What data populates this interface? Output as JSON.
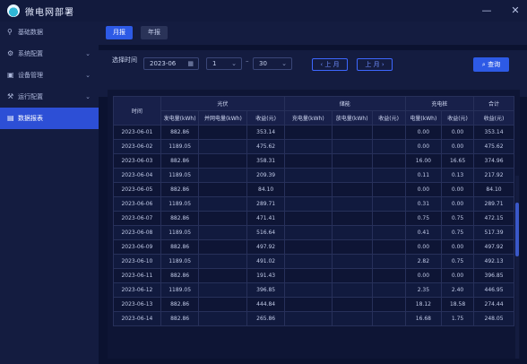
{
  "app": {
    "title": "微电网部署"
  },
  "window": {
    "minimize": "—",
    "close": "✕"
  },
  "sidebar": {
    "items": [
      {
        "label": "基础数据",
        "icon": "link-icon",
        "has_chevron": false,
        "active": false
      },
      {
        "label": "系统配置",
        "icon": "settings-icon",
        "has_chevron": true,
        "active": false
      },
      {
        "label": "设备管理",
        "icon": "device-icon",
        "has_chevron": true,
        "active": false
      },
      {
        "label": "运行配置",
        "icon": "config-icon",
        "has_chevron": true,
        "active": false
      },
      {
        "label": "数据报表",
        "icon": "report-icon",
        "has_chevron": false,
        "active": true
      }
    ]
  },
  "tabs": {
    "month": "月报",
    "year": "年报"
  },
  "filters": {
    "label": "选择时间",
    "month_value": "2023-06",
    "day_from": "1",
    "day_to": "30",
    "prev_label": "‹ 上 月",
    "next_label": "上 月 ›",
    "query_label": "查询"
  },
  "table": {
    "group_headers": {
      "time": "时间",
      "pv": "光伏",
      "storage": "储能",
      "charging": "充电桩",
      "total": "合计"
    },
    "sub_headers": {
      "pv": [
        "发电量(kWh)",
        "并网电量(kWh)",
        "收益(元)"
      ],
      "storage": [
        "充电量(kWh)",
        "放电量(kWh)",
        "收益(元)"
      ],
      "charging": [
        "电量(kWh)",
        "收益(元)"
      ],
      "total": [
        "收益(元)"
      ]
    },
    "rows": [
      [
        "2023-06-01",
        "882.86",
        "",
        "353.14",
        "",
        "",
        "",
        "0.00",
        "0.00",
        "353.14"
      ],
      [
        "2023-06-02",
        "1189.05",
        "",
        "475.62",
        "",
        "",
        "",
        "0.00",
        "0.00",
        "475.62"
      ],
      [
        "2023-06-03",
        "882.86",
        "",
        "358.31",
        "",
        "",
        "",
        "16.00",
        "16.65",
        "374.96"
      ],
      [
        "2023-06-04",
        "1189.05",
        "",
        "209.39",
        "",
        "",
        "",
        "0.11",
        "0.13",
        "217.92"
      ],
      [
        "2023-06-05",
        "882.86",
        "",
        "84.10",
        "",
        "",
        "",
        "0.00",
        "0.00",
        "84.10"
      ],
      [
        "2023-06-06",
        "1189.05",
        "",
        "289.71",
        "",
        "",
        "",
        "0.31",
        "0.00",
        "289.71"
      ],
      [
        "2023-06-07",
        "882.86",
        "",
        "471.41",
        "",
        "",
        "",
        "0.75",
        "0.75",
        "472.15"
      ],
      [
        "2023-06-08",
        "1189.05",
        "",
        "516.64",
        "",
        "",
        "",
        "0.41",
        "0.75",
        "517.39"
      ],
      [
        "2023-06-09",
        "882.86",
        "",
        "497.92",
        "",
        "",
        "",
        "0.00",
        "0.00",
        "497.92"
      ],
      [
        "2023-06-10",
        "1189.05",
        "",
        "491.02",
        "",
        "",
        "",
        "2.82",
        "0.75",
        "492.13"
      ],
      [
        "2023-06-11",
        "882.86",
        "",
        "191.43",
        "",
        "",
        "",
        "0.00",
        "0.00",
        "396.85"
      ],
      [
        "2023-06-12",
        "1189.05",
        "",
        "396.85",
        "",
        "",
        "",
        "2.35",
        "2.40",
        "446.95"
      ],
      [
        "2023-06-13",
        "882.86",
        "",
        "444.84",
        "",
        "",
        "",
        "18.12",
        "18.58",
        "274.44"
      ],
      [
        "2023-06-14",
        "882.86",
        "",
        "265.86",
        "",
        "",
        "",
        "16.68",
        "1.75",
        "248.05"
      ]
    ]
  }
}
